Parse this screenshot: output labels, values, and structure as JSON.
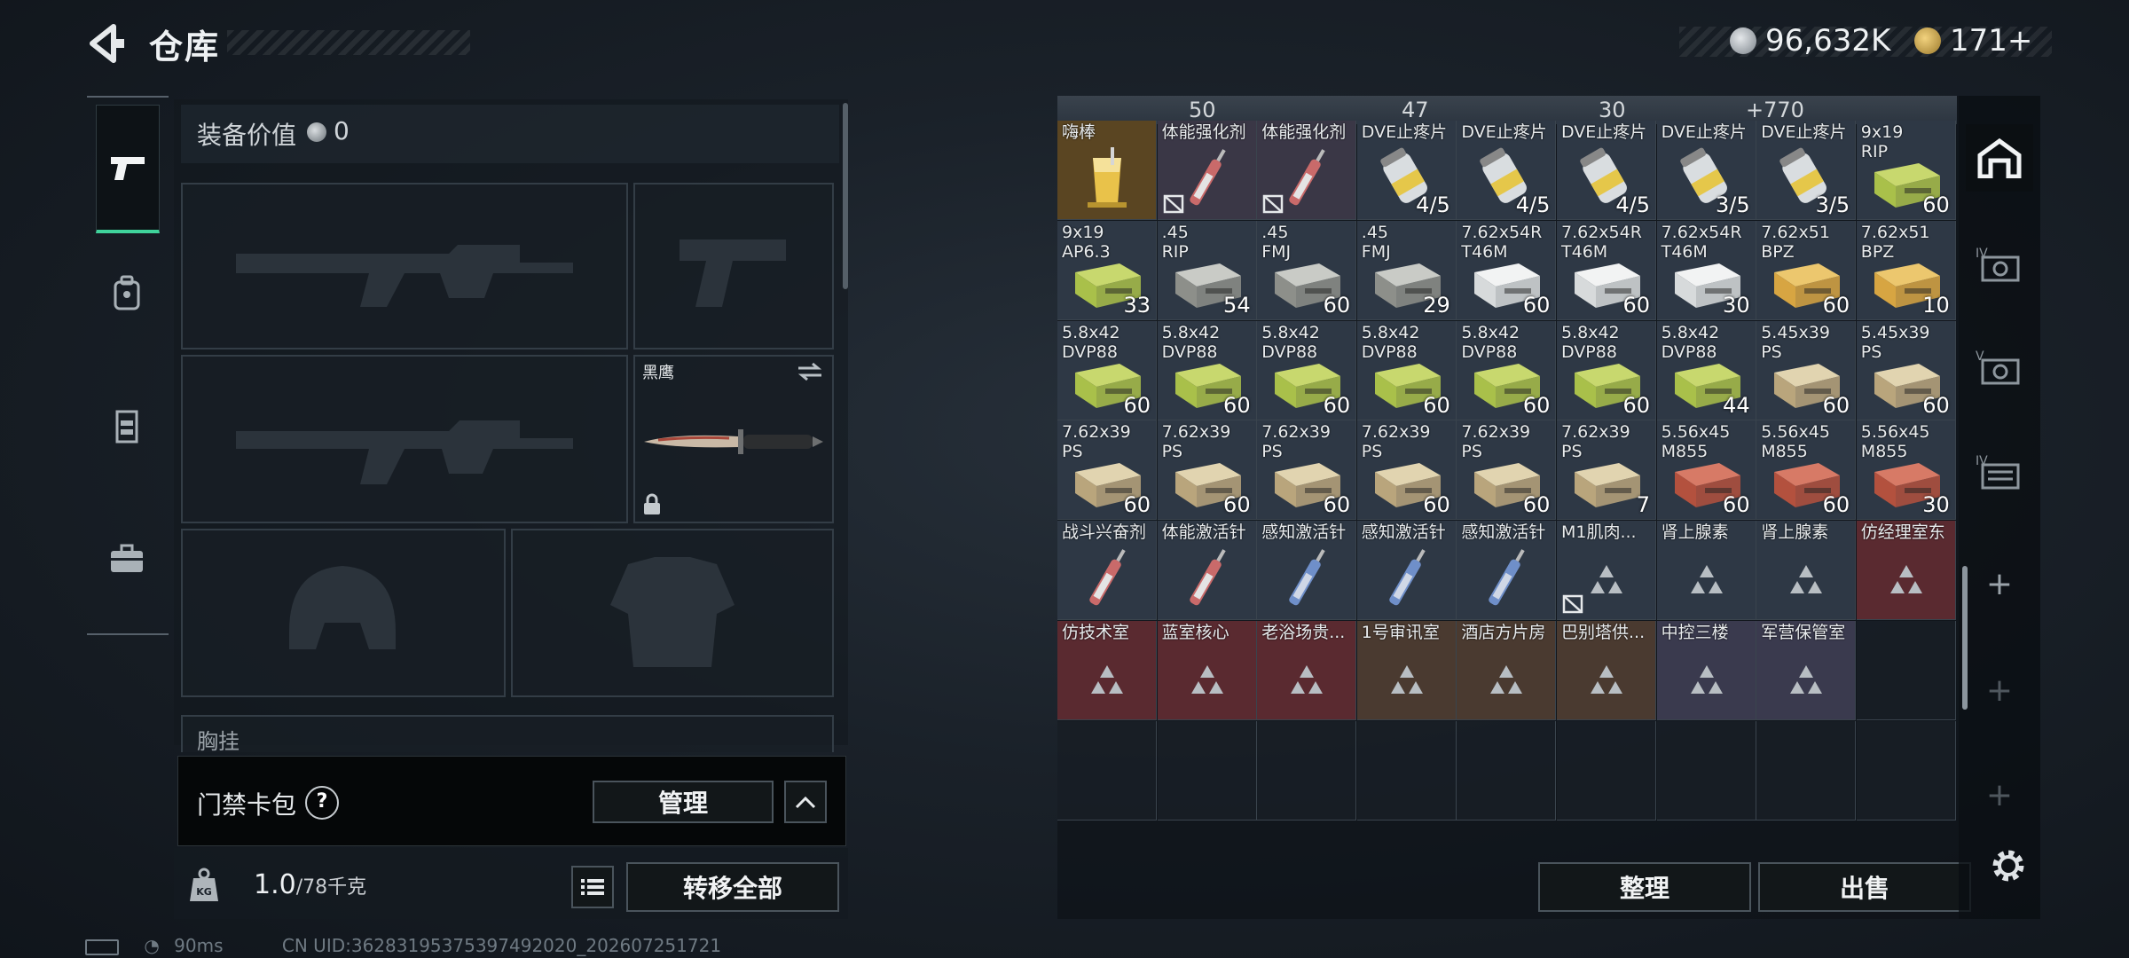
{
  "header": {
    "title": "仓库",
    "currency_silver": "96,632K",
    "currency_gold": "171+"
  },
  "equipment": {
    "value_label": "装备价值",
    "value": "0",
    "melee_name": "黑鹰",
    "partial_label": "胸挂",
    "cardpack_label": "门禁卡包",
    "help": "?",
    "manage_label": "管理",
    "weight_current": "1.0",
    "weight_max": "/78千克",
    "weight_icon_text": "KG",
    "transfer_all_label": "转移全部"
  },
  "status_bar": {
    "ping": "90ms",
    "uid": "CN UID:36283195375397492020_202607251721"
  },
  "stash_top_row": [
    "50",
    "",
    "47",
    "",
    "30",
    "",
    "+770"
  ],
  "stash_items": [
    {
      "name": "嗨棒",
      "count": "",
      "art": "drink",
      "bg": "#5a4522"
    },
    {
      "name": "体能强化剂",
      "count": "",
      "art": "syringe-red",
      "bg": "#3a3746",
      "nosell": true
    },
    {
      "name": "体能强化剂",
      "count": "",
      "art": "syringe-red",
      "bg": "#3a3746",
      "nosell": true
    },
    {
      "name": "DVE止疼片",
      "count": "4/5",
      "art": "pill",
      "bg": "#2e3845"
    },
    {
      "name": "DVE止疼片",
      "count": "4/5",
      "art": "pill",
      "bg": "#2e3845"
    },
    {
      "name": "DVE止疼片",
      "count": "4/5",
      "art": "pill",
      "bg": "#2e3845"
    },
    {
      "name": "DVE止疼片",
      "count": "3/5",
      "art": "pill",
      "bg": "#2e3845"
    },
    {
      "name": "DVE止疼片",
      "count": "3/5",
      "art": "pill",
      "bg": "#2e3845"
    },
    {
      "name": "9x19\nRIP",
      "count": "60",
      "art": "ammo-green",
      "bg": "#2e3845"
    },
    {
      "name": "9x19\nAP6.3",
      "count": "33",
      "art": "ammo-green",
      "bg": "#2e3845"
    },
    {
      "name": ".45\nRIP",
      "count": "54",
      "art": "ammo-gray",
      "bg": "#2e3845"
    },
    {
      "name": ".45\nFMJ",
      "count": "60",
      "art": "ammo-gray",
      "bg": "#2e3845"
    },
    {
      "name": ".45\nFMJ",
      "count": "29",
      "art": "ammo-gray",
      "bg": "#2e3845"
    },
    {
      "name": "7.62x54R\nT46M",
      "count": "60",
      "art": "ammo-white",
      "bg": "#2e3845"
    },
    {
      "name": "7.62x54R\nT46M",
      "count": "60",
      "art": "ammo-white",
      "bg": "#2e3845"
    },
    {
      "name": "7.62x54R\nT46M",
      "count": "30",
      "art": "ammo-white",
      "bg": "#2e3845"
    },
    {
      "name": "7.62x51\nBPZ",
      "count": "60",
      "art": "ammo-gold",
      "bg": "#2e3845"
    },
    {
      "name": "7.62x51\nBPZ",
      "count": "10",
      "art": "ammo-gold",
      "bg": "#2e3845"
    },
    {
      "name": "5.8x42\nDVP88",
      "count": "60",
      "art": "ammo-green",
      "bg": "#2e3845"
    },
    {
      "name": "5.8x42\nDVP88",
      "count": "60",
      "art": "ammo-green",
      "bg": "#2e3845"
    },
    {
      "name": "5.8x42\nDVP88",
      "count": "60",
      "art": "ammo-green",
      "bg": "#2e3845"
    },
    {
      "name": "5.8x42\nDVP88",
      "count": "60",
      "art": "ammo-green",
      "bg": "#2e3845"
    },
    {
      "name": "5.8x42\nDVP88",
      "count": "60",
      "art": "ammo-green",
      "bg": "#2e3845"
    },
    {
      "name": "5.8x42\nDVP88",
      "count": "60",
      "art": "ammo-green",
      "bg": "#2e3845"
    },
    {
      "name": "5.8x42\nDVP88",
      "count": "44",
      "art": "ammo-green",
      "bg": "#2e3845"
    },
    {
      "name": "5.45x39\nPS",
      "count": "60",
      "art": "ammo-tan",
      "bg": "#2e3845"
    },
    {
      "name": "5.45x39\nPS",
      "count": "60",
      "art": "ammo-tan",
      "bg": "#2e3845"
    },
    {
      "name": "7.62x39\nPS",
      "count": "60",
      "art": "ammo-tan",
      "bg": "#2e3845"
    },
    {
      "name": "7.62x39\nPS",
      "count": "60",
      "art": "ammo-tan",
      "bg": "#2e3845"
    },
    {
      "name": "7.62x39\nPS",
      "count": "60",
      "art": "ammo-tan",
      "bg": "#2e3845"
    },
    {
      "name": "7.62x39\nPS",
      "count": "60",
      "art": "ammo-tan",
      "bg": "#2e3845"
    },
    {
      "name": "7.62x39\nPS",
      "count": "60",
      "art": "ammo-tan",
      "bg": "#2e3845"
    },
    {
      "name": "7.62x39\nPS",
      "count": "7",
      "art": "ammo-tan",
      "bg": "#2e3845"
    },
    {
      "name": "5.56x45\nM855",
      "count": "60",
      "art": "ammo-red",
      "bg": "#2e3845"
    },
    {
      "name": "5.56x45\nM855",
      "count": "60",
      "art": "ammo-red",
      "bg": "#2e3845"
    },
    {
      "name": "5.56x45\nM855",
      "count": "30",
      "art": "ammo-red",
      "bg": "#2e3845"
    },
    {
      "name": "战斗兴奋剂",
      "count": "",
      "art": "syringe-red",
      "bg": "#2e3845"
    },
    {
      "name": "体能激活针",
      "count": "",
      "art": "syringe-red",
      "bg": "#2e3845"
    },
    {
      "name": "感知激活针",
      "count": "",
      "art": "syringe-blue",
      "bg": "#2e3845"
    },
    {
      "name": "感知激活针",
      "count": "",
      "art": "syringe-blue",
      "bg": "#2e3845"
    },
    {
      "name": "感知激活针",
      "count": "",
      "art": "syringe-blue",
      "bg": "#2e3845"
    },
    {
      "name": "M1肌肉...",
      "count": "",
      "art": "tri",
      "bg": "#2e3845",
      "nosell": true
    },
    {
      "name": "肾上腺素",
      "count": "",
      "art": "tri",
      "bg": "#2e3845"
    },
    {
      "name": "肾上腺素",
      "count": "",
      "art": "tri",
      "bg": "#2e3845"
    },
    {
      "name": "仿经理室东",
      "count": "",
      "art": "tri",
      "bg": "#5a2a30"
    },
    {
      "name": "仿技术室",
      "count": "",
      "art": "tri",
      "bg": "#5a2a30"
    },
    {
      "name": "蓝室核心",
      "count": "",
      "art": "tri",
      "bg": "#5a2a30"
    },
    {
      "name": "老浴场贵...",
      "count": "",
      "art": "tri",
      "bg": "#5a2a30"
    },
    {
      "name": "1号审讯室",
      "count": "",
      "art": "tri",
      "bg": "#4a3a30"
    },
    {
      "name": "酒店方片房",
      "count": "",
      "art": "tri",
      "bg": "#4a3a30"
    },
    {
      "name": "巴别塔供...",
      "count": "",
      "art": "tri",
      "bg": "#4a3a30"
    },
    {
      "name": "中控三楼",
      "count": "",
      "art": "tri",
      "bg": "#3a3a4e"
    },
    {
      "name": "军营保管室",
      "count": "",
      "art": "tri",
      "bg": "#3a3a4e"
    }
  ],
  "actions": {
    "sort_label": "整理",
    "sell_label": "出售"
  },
  "sidebar": {
    "add": "+"
  }
}
